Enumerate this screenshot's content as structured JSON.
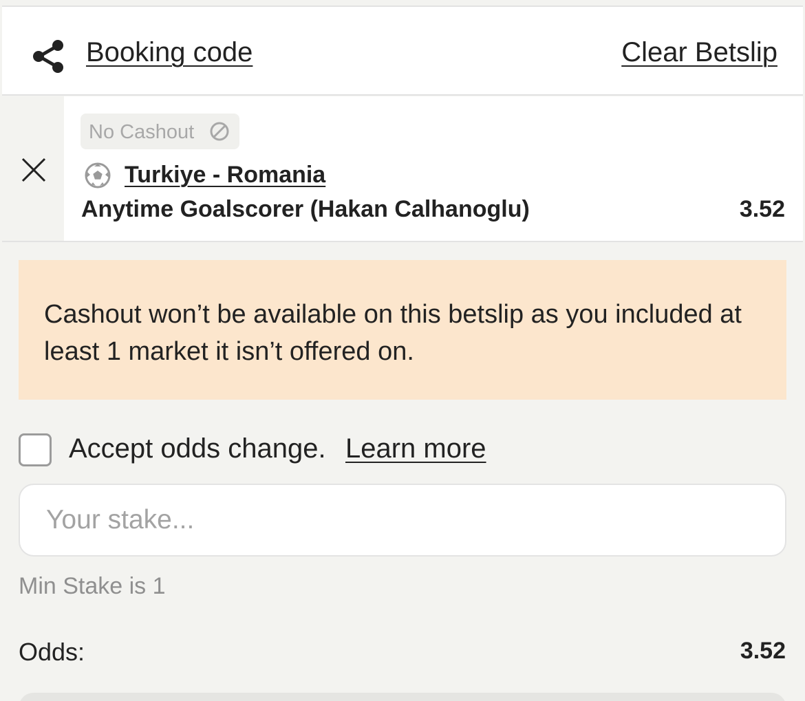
{
  "header": {
    "share_icon": "share-icon",
    "booking_code_label": "Booking code",
    "clear_betslip_label": "Clear Betslip"
  },
  "selection": {
    "remove_icon": "close-icon",
    "no_cashout_badge": "No Cashout",
    "no_cashout_icon": "prohibited-icon",
    "sport_icon": "soccer-ball-icon",
    "match": "Turkiye - Romania",
    "market": "Anytime Goalscorer (Hakan Calhanoglu)",
    "odds": "3.52"
  },
  "warning": {
    "text": "Cashout won’t be available on this betslip as you included at least 1 market it isn’t offered on.",
    "background_color": "#fce6cd"
  },
  "accept_odds": {
    "checked": false,
    "label": "Accept odds change.",
    "learn_more_label": "Learn more"
  },
  "stake": {
    "value": "",
    "placeholder": "Your stake...",
    "min_stake_text": "Min Stake is 1"
  },
  "summary": {
    "odds_label": "Odds:",
    "odds_value": "3.52"
  }
}
